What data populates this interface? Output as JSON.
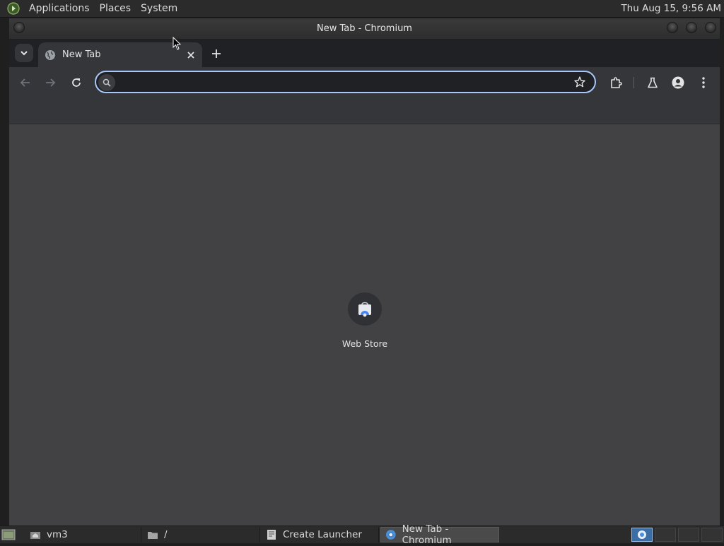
{
  "top_panel": {
    "menus": [
      "Applications",
      "Places",
      "System"
    ],
    "clock": "Thu Aug 15,  9:56 AM"
  },
  "window": {
    "title": "New Tab - Chromium"
  },
  "tabs": [
    {
      "title": "New Tab",
      "active": true
    }
  ],
  "omnibox": {
    "value": "",
    "placeholder": ""
  },
  "shortcuts": [
    {
      "label": "Web Store",
      "icon": "web-store-icon"
    }
  ],
  "taskbar": {
    "tasks": [
      {
        "label": "vm3",
        "icon": "home-folder-icon",
        "active": false
      },
      {
        "label": "/",
        "icon": "folder-icon",
        "active": false
      },
      {
        "label": "Create Launcher",
        "icon": "launcher-icon",
        "active": false
      },
      {
        "label": "New Tab - Chromium",
        "icon": "chromium-icon",
        "active": true
      }
    ]
  },
  "colors": {
    "accent": "#a8c7fa",
    "tabstrip": "#202124",
    "toolbar": "#35363a",
    "content": "#424245"
  }
}
